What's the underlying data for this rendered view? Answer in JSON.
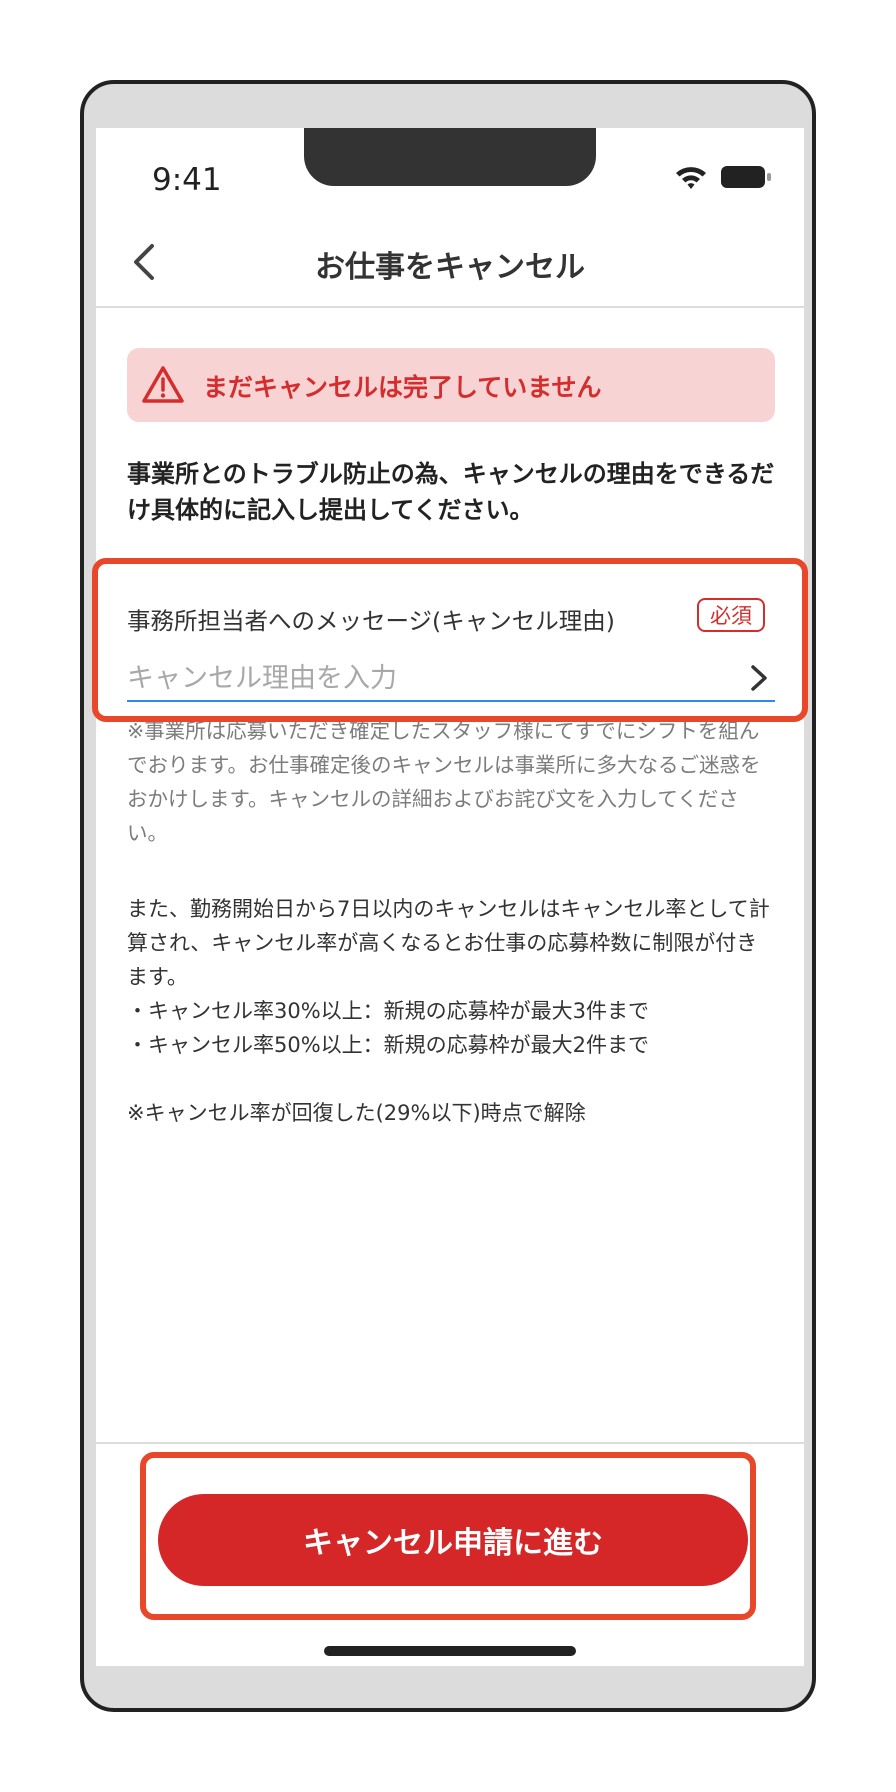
{
  "status_bar": {
    "time": "9:41",
    "icons": [
      "wifi-icon",
      "battery-icon"
    ]
  },
  "nav": {
    "back_icon": "chevron-left-icon",
    "title": "お仕事をキャンセル"
  },
  "alert": {
    "icon": "warning-triangle-icon",
    "text": "まだキャンセルは完了していません"
  },
  "intro": {
    "text": "事業所とのトラブル防止の為、キャンセルの理由をできるだけ具体的に記入し提出してください。"
  },
  "reason_field": {
    "label": "事務所担当者へのメッセージ(キャンセル理由)",
    "required_badge": "必須",
    "placeholder": "キャンセル理由を入力",
    "value": ""
  },
  "note": {
    "text": "※事業所は応募いただき確定したスタッフ様にてすでにシフトを組んでおります。お仕事確定後のキャンセルは事業所に多大なるご迷惑をおかけします。キャンセルの詳細およびお詫び文を入力してください。"
  },
  "terms": {
    "paragraph": "また、勤務開始日から7日以内のキャンセルはキャンセル率として計算され、キャンセル率が高くなるとお仕事の応募枠数に制限が付きます。",
    "rule1": "・キャンセル率30%以上：新規の応募枠が最大3件まで",
    "rule2": "・キャンセル率50%以上：新規の応募枠が最大2件まで",
    "footnote": "※キャンセル率が回復した(29%以下)時点で解除"
  },
  "submit_button": {
    "label": "キャンセル申請に進む"
  },
  "colors": {
    "accent_red": "#d52628",
    "alert_bg": "#f8d3d4",
    "input_underline": "#2a8af0",
    "highlight_orange": "#e8472a"
  }
}
